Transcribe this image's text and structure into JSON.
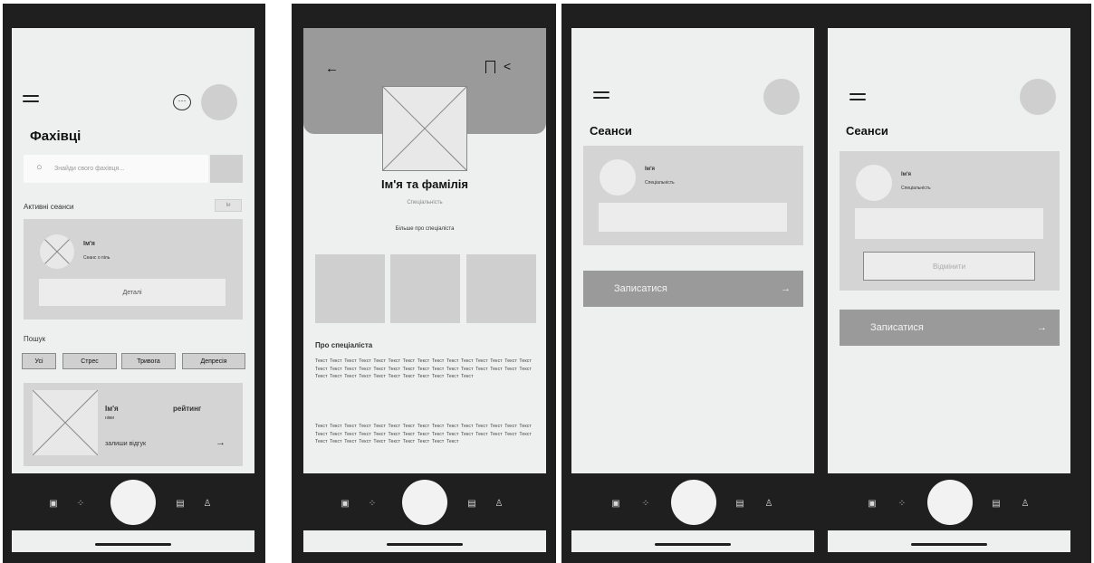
{
  "screen1": {
    "title": "Фахівці",
    "search_placeholder": "Знайди свого фахівця...",
    "active_sessions_label": "Активні сеанси",
    "active_sessions_more": "Іи",
    "session_card": {
      "name": "Ім'я",
      "subtitle": "Сеанс о піль",
      "details_button": "Деталі"
    },
    "search_label": "Пошук",
    "filters": [
      "Усі",
      "Стрес",
      "Тривога",
      "Депресія"
    ],
    "result_card": {
      "name": "Ім'я",
      "subtitle": "ніжи",
      "rating_label": "рейтинг",
      "review_label": "залиши відгук",
      "arrow": "→"
    }
  },
  "screen2": {
    "back_arrow": "←",
    "bookmark_icon": "bookmark-icon",
    "share_icon": "share-icon",
    "name": "Ім'я та фамілія",
    "specialty": "Спеціальність",
    "more_link": "Більше про спеціаліста",
    "about_title": "Про спеціаліста",
    "about_text_1": "Текст Текст Текст Текст Текст Текст Текст Текст Текст Текст Текст Текст Текст Текст Текст Текст Текст Текст Текст Текст Текст Текст Текст Текст Текст Текст Текст Текст Текст Текст Текст Текст Текст Текст Текст Текст Текст Текст Текст Текст Текст",
    "about_text_2": "Текст Текст Текст Текст Текст Текст Текст Текст Текст Текст Текст Текст Текст Текст Текст Текст Текст Текст Текст Текст Текст Текст Текст Текст Текст Текст Текст Текст Текст Текст Текст Текст Текст Текст Текст Текст Текст Текст Текст Текст"
  },
  "screen3": {
    "title": "Сеанси",
    "card": {
      "name": "Ім'я",
      "subtitle": "Спеціальність"
    },
    "book_button": "Записатися",
    "arrow": "→"
  },
  "screen4": {
    "title": "Сеанси",
    "card": {
      "name": "Ім'я",
      "subtitle": "Спеціальність"
    },
    "cancel_button": "Відмінити",
    "book_button": "Записатися",
    "arrow": "→"
  },
  "navbar_icons": [
    "calendar-icon",
    "grid-icon",
    "home-fab",
    "document-icon",
    "user-icon"
  ],
  "colors": {
    "background": "#1f1f1f",
    "screen": "#eef0f0",
    "card": "#d4d4d4",
    "button": "#9a9a9a"
  }
}
